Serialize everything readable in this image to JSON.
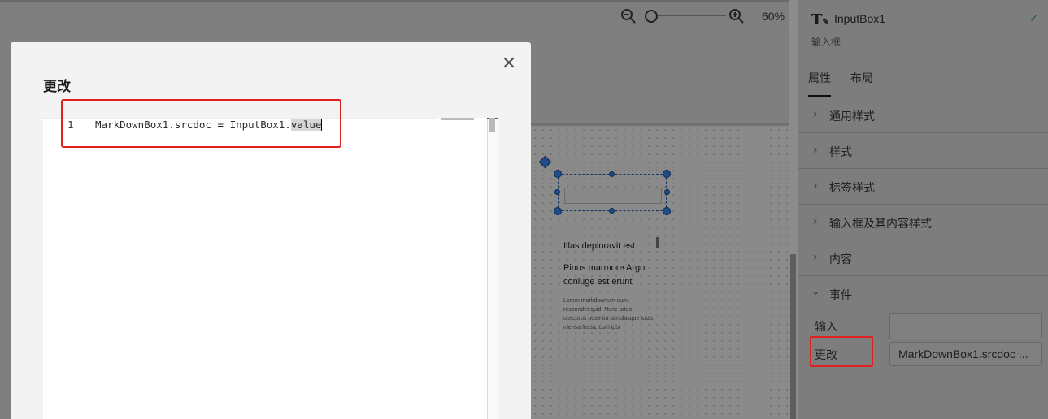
{
  "toolbar": {
    "zoom_level": "60%",
    "zoom_out_icon": "zoom-out-icon",
    "zoom_in_icon": "zoom-in-icon"
  },
  "canvas": {
    "markdown_preview": {
      "heading1": "Illas deploravit est",
      "heading2": "Pinus marmore Argo coniuge est erunt",
      "paragraph": "Lorem markdownum cum, respondet quid. Nunc artus obscurus potentia famulasque totas mensa Iussa, cum ipsi"
    }
  },
  "panel": {
    "component_name": "InputBox1",
    "component_type": "输入框",
    "tabs": [
      "属性",
      "布局"
    ],
    "active_tab": "属性",
    "sections": [
      "通用样式",
      "样式",
      "标签样式",
      "输入框及其内容样式",
      "内容"
    ],
    "events_section": "事件",
    "events": {
      "input_label": "输入",
      "input_value": "",
      "change_label": "更改",
      "change_value": "MarkDownBox1.srcdoc ..."
    },
    "colors": {
      "highlight": "#e0201f",
      "confirm": "#1f5d2c"
    }
  },
  "modal": {
    "title": "更改",
    "close_icon": "close-icon",
    "editor": {
      "line_number": "1",
      "code_prefix": "MarkDownBox1.srcdoc = InputBox1.",
      "code_selected": "value"
    }
  }
}
